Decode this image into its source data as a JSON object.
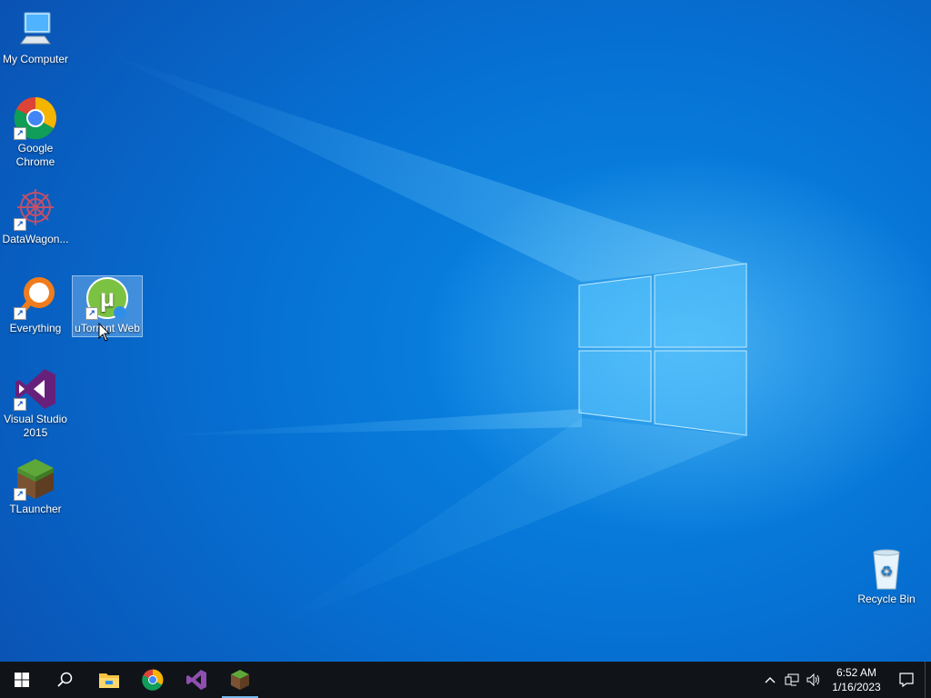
{
  "desktop": {
    "icons": [
      {
        "label": "My Computer",
        "icon": "computer-icon"
      },
      {
        "label": "Google Chrome",
        "icon": "chrome-icon"
      },
      {
        "label": "DataWagon...",
        "icon": "datawagon-icon"
      },
      {
        "label": "Everything",
        "icon": "everything-search-icon"
      },
      {
        "label": "uTorrent Web",
        "icon": "utorrent-icon"
      },
      {
        "label": "Visual Studio 2015",
        "icon": "visual-studio-icon"
      },
      {
        "label": "TLauncher",
        "icon": "minecraft-grass-block-icon"
      },
      {
        "label": "Recycle Bin",
        "icon": "recycle-bin-icon"
      }
    ],
    "selected_icon": "uTorrent Web"
  },
  "taskbar": {
    "pinned": [
      "start-icon",
      "search-icon",
      "file-explorer-icon",
      "chrome-icon",
      "visual-studio-icon",
      "tlauncher-icon"
    ],
    "active": "tlauncher-icon",
    "clock": {
      "time": "6:52 AM",
      "date": "1/16/2023"
    },
    "tray": [
      "show-hidden-icons-chevron",
      "network-icon",
      "volume-icon",
      "action-center-icon"
    ]
  },
  "colors": {
    "taskbar": "#101419",
    "desktop_accent": "#0078d7",
    "active_indicator": "#76b9ed"
  }
}
